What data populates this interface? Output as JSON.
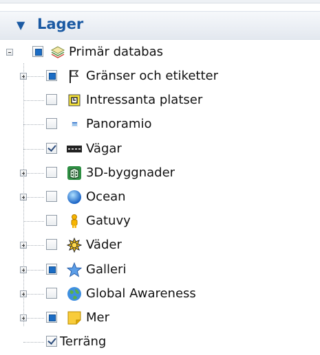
{
  "panel": {
    "title": "Lager"
  },
  "tree": {
    "root": {
      "label": "Primär databas",
      "expander": "minus",
      "check": "partial",
      "icon": "layers-icon"
    },
    "items": [
      {
        "label": "Gränser och etiketter",
        "expander": "plus",
        "check": "partial",
        "icon": "flags-icon"
      },
      {
        "label": "Intressanta platser",
        "expander": "none",
        "check": "unchecked",
        "icon": "poi-icon"
      },
      {
        "label": "Panoramio",
        "expander": "none",
        "check": "unchecked",
        "icon": "panoramio-icon"
      },
      {
        "label": "Vägar",
        "expander": "none",
        "check": "checked",
        "icon": "road-icon"
      },
      {
        "label": "3D-byggnader",
        "expander": "plus",
        "check": "unchecked",
        "icon": "building-icon"
      },
      {
        "label": "Ocean",
        "expander": "plus",
        "check": "unchecked",
        "icon": "ocean-icon"
      },
      {
        "label": "Gatuvy",
        "expander": "none",
        "check": "unchecked",
        "icon": "pegman-icon"
      },
      {
        "label": "Väder",
        "expander": "plus",
        "check": "unchecked",
        "icon": "sun-icon"
      },
      {
        "label": "Galleri",
        "expander": "plus",
        "check": "partial",
        "icon": "star-icon"
      },
      {
        "label": "Global Awareness",
        "expander": "plus",
        "check": "unchecked",
        "icon": "globe-icon"
      },
      {
        "label": "Mer",
        "expander": "plus",
        "check": "partial",
        "icon": "note-icon"
      },
      {
        "label": "Terräng",
        "expander": "none",
        "check": "checked",
        "icon": ""
      }
    ]
  },
  "colors": {
    "accent": "#1b5aa3",
    "checkbox_fill": "#1b6cc4"
  }
}
